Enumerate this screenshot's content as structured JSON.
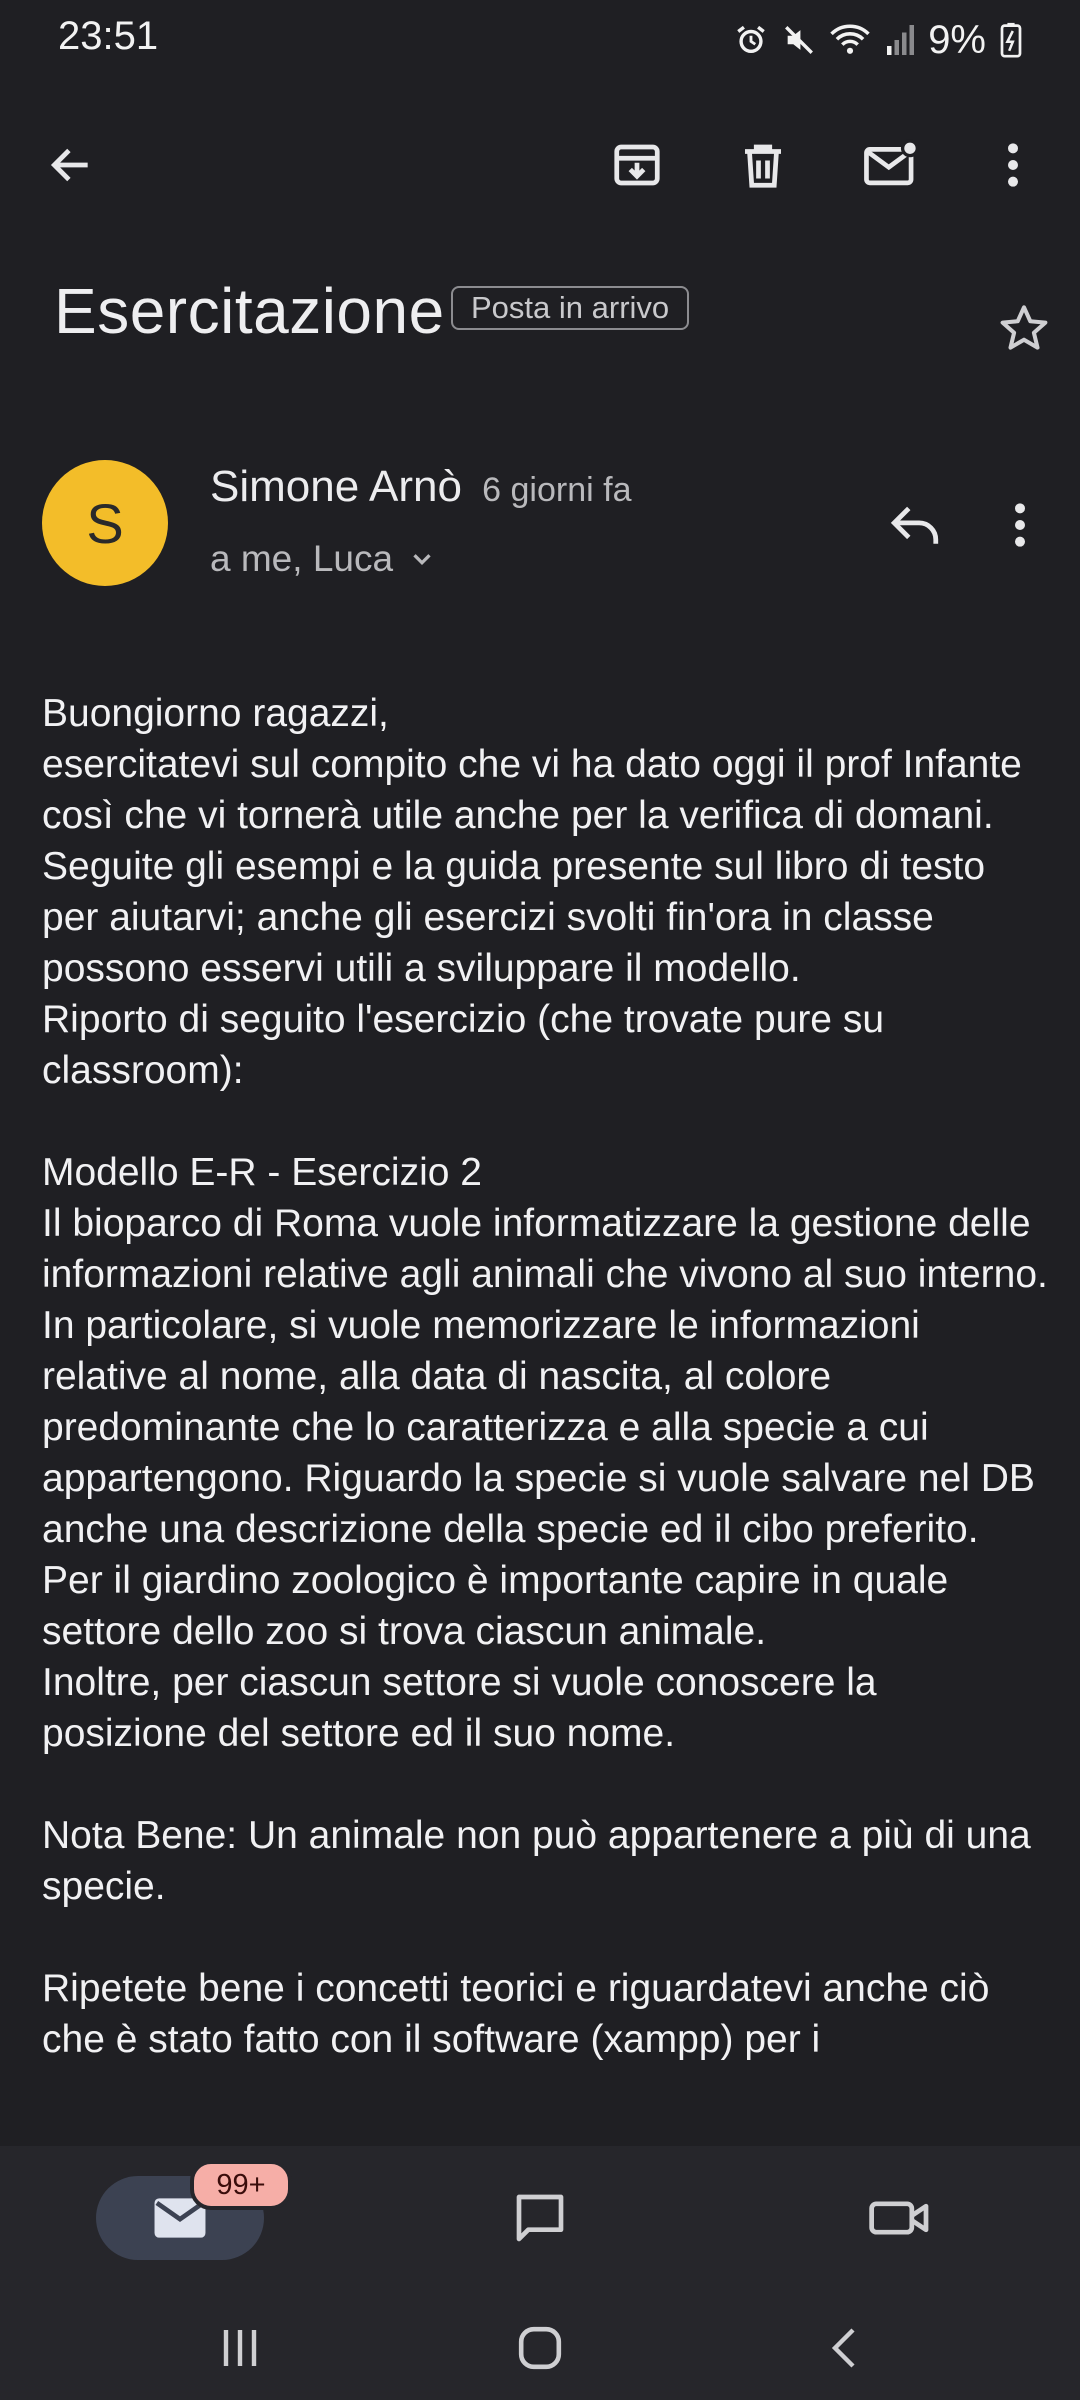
{
  "status_bar": {
    "time": "23:51",
    "icons": [
      "alarm-icon",
      "mute-icon",
      "wifi-icon",
      "signal-icon"
    ],
    "battery": "9%"
  },
  "toolbar": {
    "icons": [
      "back-arrow-icon",
      "archive-icon",
      "delete-icon",
      "mark-unread-icon",
      "more-vert-icon"
    ]
  },
  "email": {
    "subject": "Esercitazione",
    "label": "Posta in arrivo",
    "sender": {
      "initial": "S",
      "name": "Simone Arnò",
      "time": "6 giorni fa",
      "recipients": "a me, Luca",
      "avatar_color": "#f3bd29"
    },
    "body": [
      "Buongiorno ragazzi,",
      "esercitatevi sul compito che vi ha dato oggi il prof Infante così che vi tornerà utile anche per la verifica di domani.",
      "Seguite gli esempi e la guida presente sul libro di testo per aiutarvi; anche gli esercizi svolti fin'ora in classe possono esservi utili a sviluppare il modello.",
      "Riporto di seguito l'esercizio (che trovate pure su classroom):",
      "",
      "Modello E-R - Esercizio 2",
      "Il bioparco di Roma vuole informatizzare la gestione delle informazioni relative agli animali che vivono al suo interno. In particolare, si vuole memorizzare le informazioni relative al nome, alla data di nascita, al colore predominante che lo caratterizza e alla specie a cui appartengono. Riguardo la specie si vuole salvare nel DB anche una descrizione della specie ed il cibo preferito.",
      "Per il giardino zoologico è importante capire in quale settore dello zoo si trova ciascun animale.",
      "Inoltre, per ciascun settore si vuole conoscere la posizione del settore ed il suo nome.",
      "",
      "Nota Bene: Un animale non può appartenere a più di una specie.",
      "",
      "Ripetete bene i concetti teorici e riguardatevi anche ciò che è stato fatto con il software (xampp) per i"
    ]
  },
  "bottom_nav": {
    "mail_badge": "99+",
    "items": [
      "mail-icon",
      "chat-icon",
      "meet-icon"
    ]
  },
  "system_nav": [
    "recents-icon",
    "home-icon",
    "back-icon"
  ],
  "colors": {
    "background": "#1f1f23",
    "nav_background": "#26262b",
    "active_pill": "#3c4252",
    "badge": "#f6aea7"
  }
}
